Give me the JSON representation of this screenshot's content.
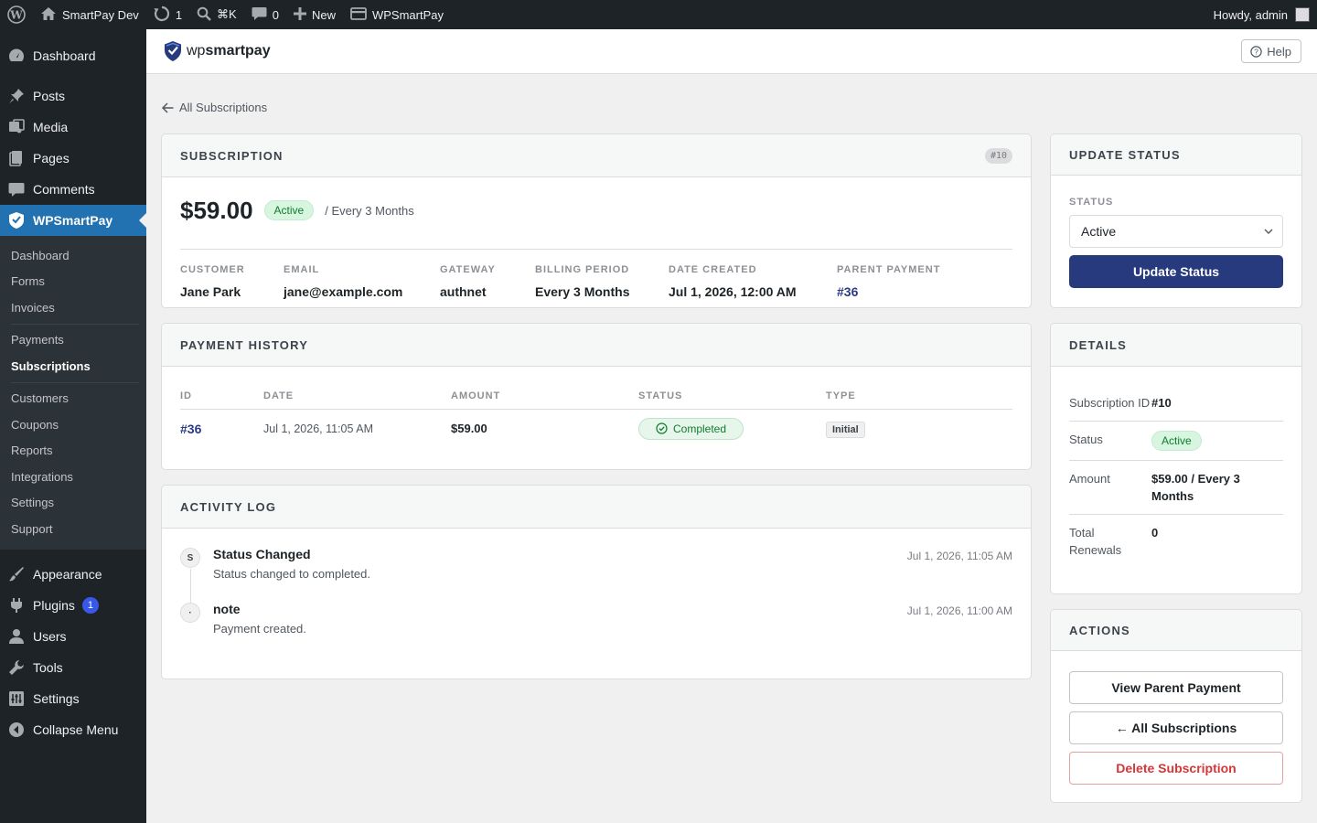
{
  "adminbar": {
    "site_name": "SmartPay Dev",
    "updates_count": "1",
    "search_shortcut": "⌘K",
    "comments_count": "0",
    "new_label": "New",
    "plugin_label": "WPSmartPay",
    "howdy": "Howdy, admin"
  },
  "sidebar": {
    "dashboard": "Dashboard",
    "posts": "Posts",
    "media": "Media",
    "pages": "Pages",
    "comments": "Comments",
    "wpsmartpay": "WPSmartPay",
    "submenu": {
      "dashboard": "Dashboard",
      "forms": "Forms",
      "invoices": "Invoices",
      "payments": "Payments",
      "subscriptions": "Subscriptions",
      "customers": "Customers",
      "coupons": "Coupons",
      "reports": "Reports",
      "integrations": "Integrations",
      "settings": "Settings",
      "support": "Support"
    },
    "appearance": "Appearance",
    "plugins": "Plugins",
    "plugins_badge": "1",
    "users": "Users",
    "tools": "Tools",
    "settings": "Settings",
    "collapse": "Collapse Menu"
  },
  "header": {
    "logo_wp": "wp",
    "logo_brand": "smartpay",
    "help_label": "Help"
  },
  "breadcrumb": {
    "back_label": "All Subscriptions"
  },
  "subscription": {
    "heading": "SUBSCRIPTION",
    "id_chip": "#10",
    "amount": "$59.00",
    "status": "Active",
    "period": "/ Every 3 Months",
    "meta": {
      "customer_label": "CUSTOMER",
      "customer": "Jane Park",
      "email_label": "EMAIL",
      "email": "jane@example.com",
      "gateway_label": "GATEWAY",
      "gateway": "authnet",
      "billing_label": "BILLING PERIOD",
      "billing": "Every 3 Months",
      "created_label": "DATE CREATED",
      "created": "Jul 1, 2026, 12:00 AM",
      "parent_label": "PARENT PAYMENT",
      "parent": "#36"
    }
  },
  "payment_history": {
    "heading": "PAYMENT HISTORY",
    "columns": [
      "ID",
      "DATE",
      "AMOUNT",
      "STATUS",
      "TYPE"
    ],
    "rows": [
      {
        "id": "#36",
        "date": "Jul 1, 2026, 11:05 AM",
        "amount": "$59.00",
        "status": "Completed",
        "type": "Initial"
      }
    ]
  },
  "activity_log": {
    "heading": "ACTIVITY LOG",
    "items": [
      {
        "initial": "S",
        "title": "Status Changed",
        "desc": "Status changed to completed.",
        "time": "Jul 1, 2026, 11:05 AM"
      },
      {
        "initial": "·",
        "title": "note",
        "desc": "Payment created.",
        "time": "Jul 1, 2026, 11:00 AM"
      }
    ]
  },
  "update_status": {
    "heading": "UPDATE STATUS",
    "field_label": "STATUS",
    "selected": "Active",
    "button": "Update Status"
  },
  "details": {
    "heading": "DETAILS",
    "rows": [
      {
        "key": "Subscription ID",
        "value": "#10"
      },
      {
        "key": "Status",
        "value": "Active"
      },
      {
        "key": "Amount",
        "value": "$59.00 / Every 3 Months"
      },
      {
        "key": "Total Renewals",
        "value": "0"
      }
    ]
  },
  "actions": {
    "heading": "ACTIONS",
    "view_parent": "View Parent Payment",
    "all_subscriptions": "← All Subscriptions",
    "delete": "Delete Subscription"
  },
  "colors": {
    "accent": "#283a7e",
    "wp_admin_blue": "#2271b1",
    "success": "#107c2e",
    "danger": "#d63638"
  }
}
